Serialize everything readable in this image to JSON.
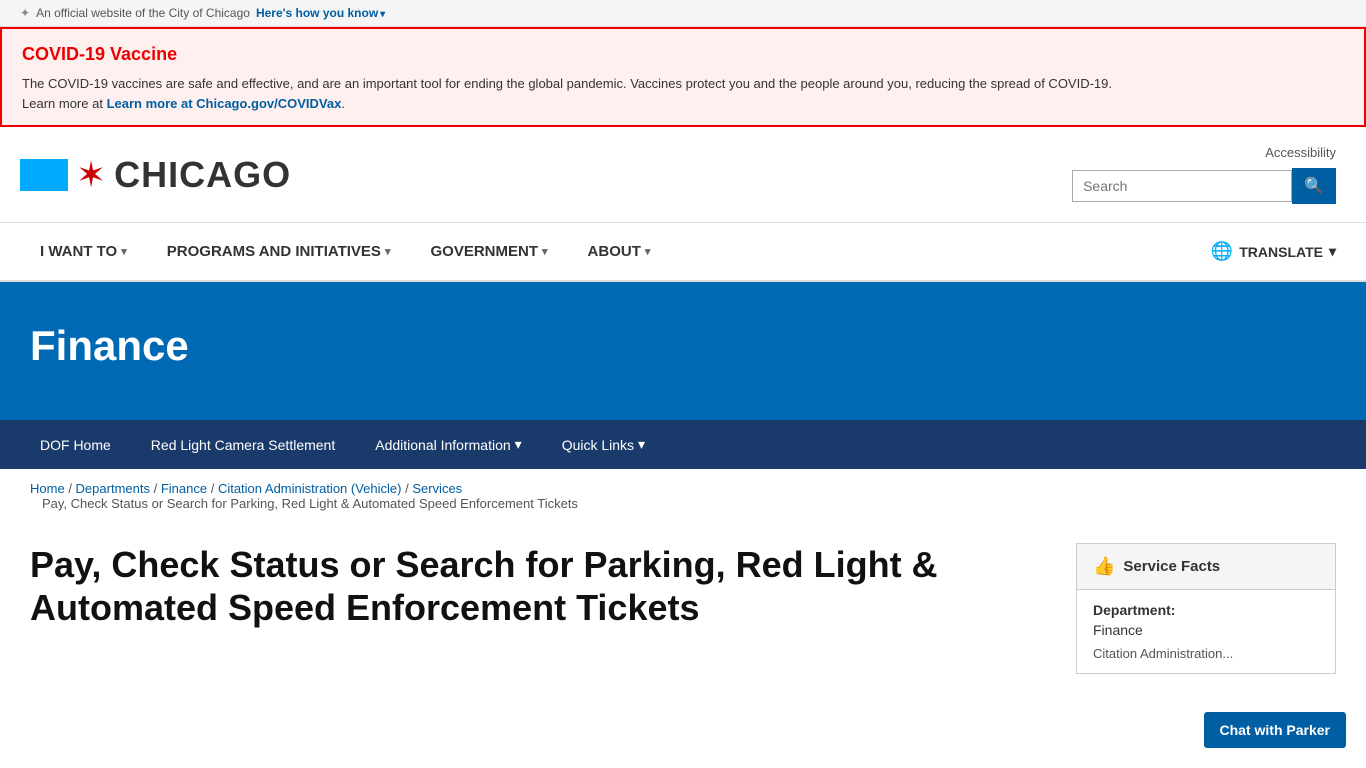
{
  "topBar": {
    "official_text": "An official website of the City of Chicago",
    "how_link": "Here's how you know"
  },
  "covidBanner": {
    "title": "COVID-19 Vaccine",
    "body": "The COVID-19 vaccines are safe and effective, and are an important tool for ending the global pandemic. Vaccines protect you and the people around you, reducing the spread of COVID-19.",
    "learn_prefix": "Learn more at",
    "learn_link": "Learn more at Chicago.gov/COVIDVax",
    "learn_href": "#"
  },
  "header": {
    "logo_alt": "City of Chicago",
    "logo_word": "CHICAGO",
    "accessibility": "Accessibility",
    "search_placeholder": "Search"
  },
  "mainNav": {
    "items": [
      {
        "label": "I WANT TO",
        "hasDropdown": true
      },
      {
        "label": "PROGRAMS AND INITIATIVES",
        "hasDropdown": true
      },
      {
        "label": "GOVERNMENT",
        "hasDropdown": true
      },
      {
        "label": "ABOUT",
        "hasDropdown": true
      }
    ],
    "translate_label": "TRANSLATE",
    "translate_icon": "🌐"
  },
  "hero": {
    "title": "Finance"
  },
  "subNav": {
    "items": [
      {
        "label": "DOF Home",
        "hasDropdown": false
      },
      {
        "label": "Red Light Camera Settlement",
        "hasDropdown": false
      },
      {
        "label": "Additional Information",
        "hasDropdown": true
      },
      {
        "label": "Quick Links",
        "hasDropdown": true
      }
    ]
  },
  "breadcrumb": {
    "items": [
      {
        "label": "Home",
        "href": "#"
      },
      {
        "label": "Departments",
        "href": "#"
      },
      {
        "label": "Finance",
        "href": "#"
      },
      {
        "label": "Citation Administration (Vehicle)",
        "href": "#"
      },
      {
        "label": "Services",
        "href": "#"
      }
    ],
    "current": "Pay, Check Status or Search for Parking, Red Light & Automated Speed Enforcement Tickets"
  },
  "mainContent": {
    "title": "Pay, Check Status or Search for Parking, Red Light & Automated Speed Enforcement Tickets"
  },
  "sidebar": {
    "service_facts_label": "Service Facts",
    "department_label": "Department:",
    "department_value": "Finance",
    "sub_label": "Citation Administration..."
  },
  "chatButton": {
    "label": "Chat with Parker"
  }
}
